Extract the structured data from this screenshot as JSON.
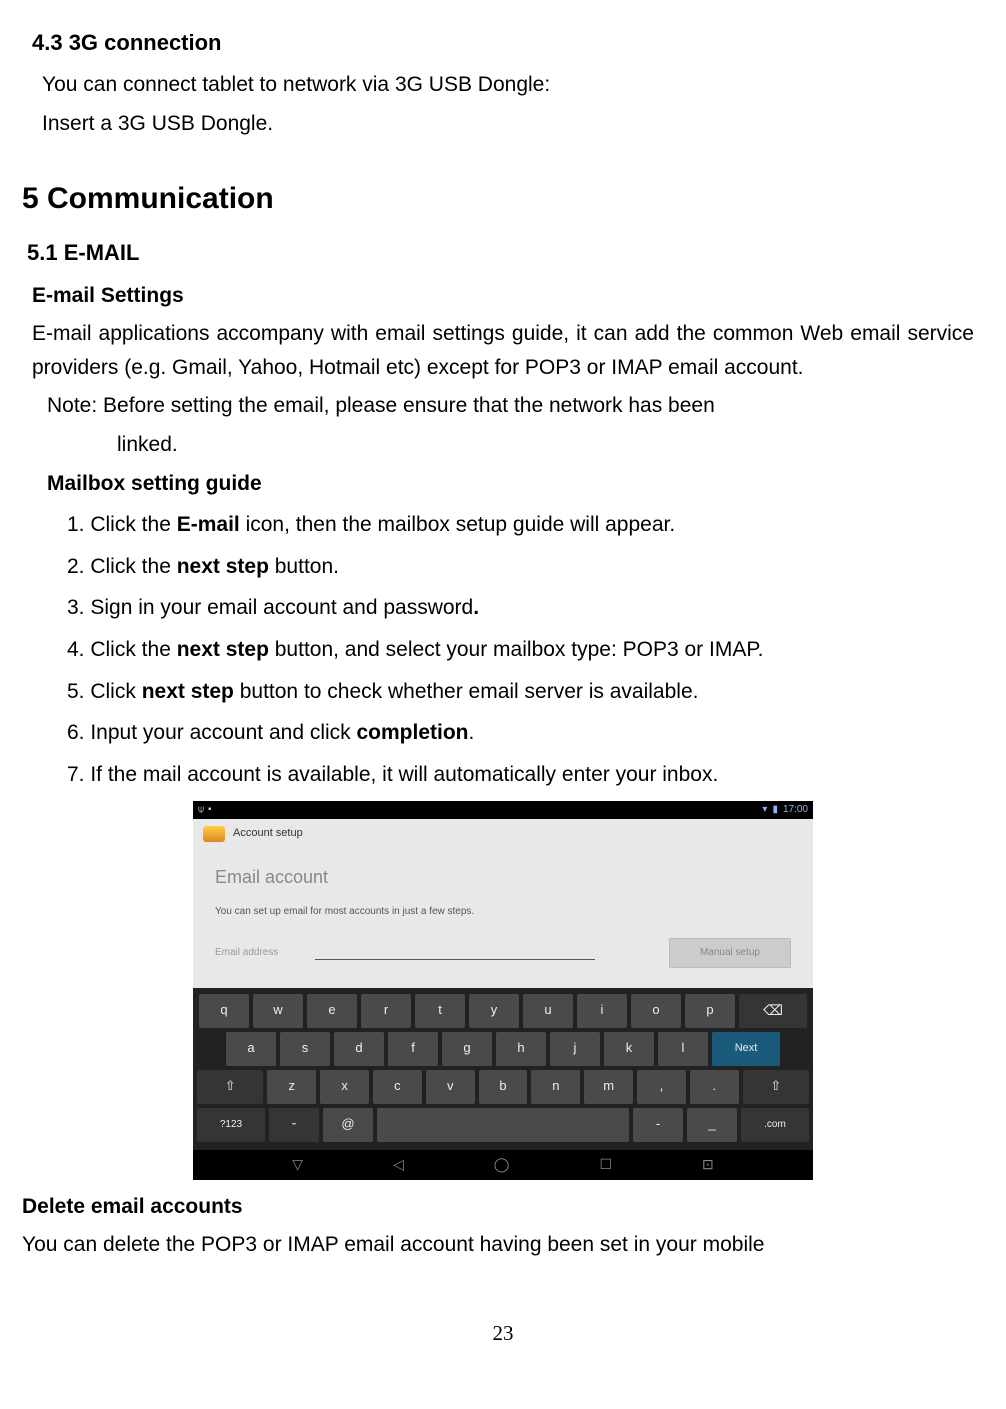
{
  "s43": {
    "heading": "4.3    3G connection",
    "line1": "You can connect tablet to network via 3G USB Dongle:",
    "line2": "Insert a 3G USB Dongle."
  },
  "s5": {
    "heading": "5 Communication"
  },
  "s51": {
    "heading": "5.1 E-MAIL",
    "settings_heading": "E-mail Settings",
    "settings_body": "E-mail applications accompany with email settings guide, it can add the common Web email service providers (e.g. Gmail, Yahoo, Hotmail etc) except for POP3 or IMAP email account.",
    "note_prefix": "Note: Before setting the email, please ensure that the network has been",
    "note_cont": "linked.",
    "guide_heading": "Mailbox setting guide",
    "step1_pre": "1. Click the ",
    "step1_bold": "E-mail",
    "step1_post": " icon, then the mailbox setup guide will appear.",
    "step2_pre": "2. Click the ",
    "step2_bold": "next step",
    "step2_post": " button.",
    "step3": "3. Sign in your email account and password.",
    "step4_pre": "4. Click the ",
    "step4_bold": "next step",
    "step4_post": " button, and select your mailbox type: POP3 or IMAP.",
    "step5_pre": "5. Click ",
    "step5_bold": "next step",
    "step5_post": " button to check whether email server is available.",
    "step6_pre": "6. Input your account and click ",
    "step6_bold": "completion",
    "step6_post": ".",
    "step7": "7. If the mail account is available, it will automatically enter your inbox."
  },
  "screenshot": {
    "time": "17:00",
    "app_title": "Account setup",
    "main_title": "Email account",
    "subtitle": "You can set up email for most accounts in just a few steps.",
    "field_label": "Email address",
    "manual_btn": "Manual setup",
    "keys_row1": [
      "q",
      "w",
      "e",
      "r",
      "t",
      "y",
      "u",
      "i",
      "o",
      "p"
    ],
    "keys_row2": [
      "a",
      "s",
      "d",
      "f",
      "g",
      "h",
      "j",
      "k",
      "l"
    ],
    "next_key": "Next",
    "keys_row3": [
      "z",
      "x",
      "c",
      "v",
      "b",
      "n",
      "m",
      ",",
      "."
    ],
    "sym_key": "?123",
    "at_key": "@",
    "dash_key": "-",
    "under_key": "_",
    "com_key": ".com"
  },
  "delete": {
    "heading": "Delete email accounts",
    "body": "You can delete the POP3 or IMAP email account having been set in your mobile"
  },
  "page_number": "23"
}
